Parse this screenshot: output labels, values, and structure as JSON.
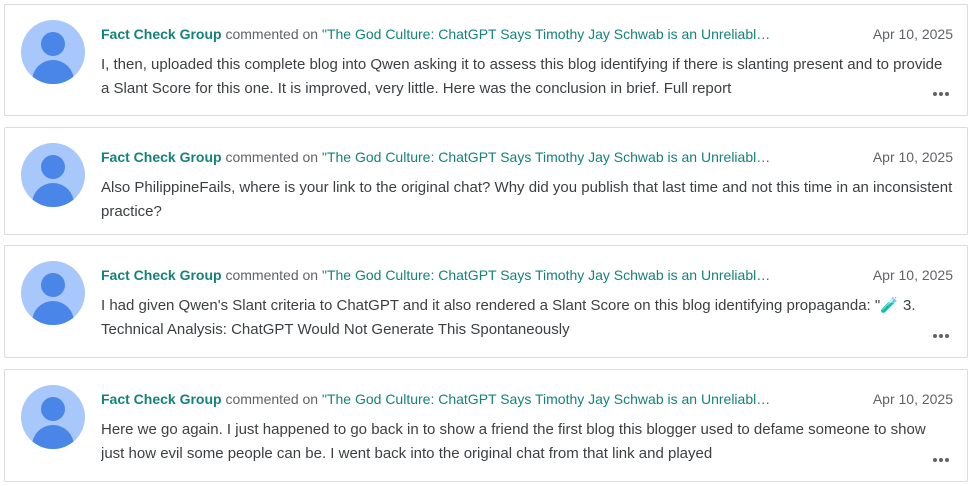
{
  "comments": [
    {
      "author": "Fact Check Group",
      "verb": "commented on",
      "post_title": "\"The God Culture: ChatGPT Says Timothy Jay Schwab is an Unreliabl…",
      "date": "Apr 10, 2025",
      "text": "I, then, uploaded this complete blog into Qwen asking it to assess this blog identifying if there is slanting present and to provide a Slant Score for this one. It is improved, very little. Here was the conclusion in brief. Full report",
      "has_more": true
    },
    {
      "author": "Fact Check Group",
      "verb": "commented on",
      "post_title": "\"The God Culture: ChatGPT Says Timothy Jay Schwab is an Unreliabl…",
      "date": "Apr 10, 2025",
      "text": "Also PhilippineFails, where is your link to the original chat? Why did you publish that last time and not this time in an inconsistent practice?",
      "has_more": false
    },
    {
      "author": "Fact Check Group",
      "verb": "commented on",
      "post_title": "\"The God Culture: ChatGPT Says Timothy Jay Schwab is an Unreliabl…",
      "date": "Apr 10, 2025",
      "text": "I had given Qwen's Slant criteria to ChatGPT and it also rendered a Slant Score on this blog identifying propaganda: \"🧪 3. Technical Analysis: ChatGPT Would Not Generate This Spontaneously",
      "has_more": true
    },
    {
      "author": "Fact Check Group",
      "verb": "commented on",
      "post_title": "\"The God Culture: ChatGPT Says Timothy Jay Schwab is an Unreliabl…",
      "date": "Apr 10, 2025",
      "text": "Here we go again. I just happened to go back in to show a friend the first blog this blogger used to defame someone to show just how evil some people can be. I went back into the original chat from that link and played",
      "has_more": true
    }
  ],
  "icons": {
    "avatar": "person-avatar-icon",
    "more": "more-horizontal-icon"
  },
  "colors": {
    "accent": "#13837a",
    "avatar_bg": "#a8c7fa",
    "avatar_fg": "#4a86e8",
    "border": "#dadce0"
  }
}
